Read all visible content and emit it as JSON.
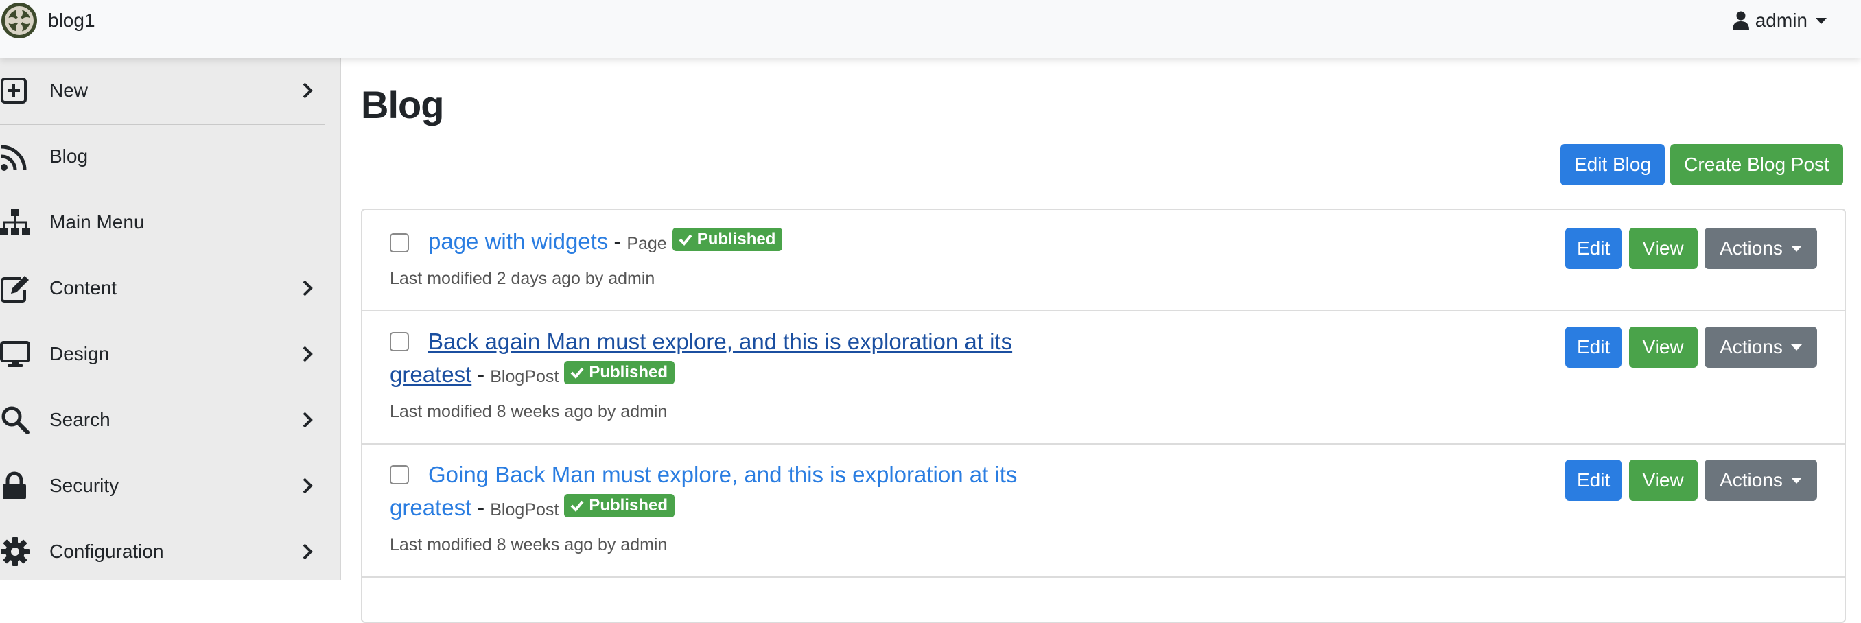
{
  "header": {
    "site_name": "blog1",
    "user": "admin"
  },
  "sidebar": {
    "items": [
      {
        "label": "New",
        "icon": "plus-square-icon",
        "has_submenu": true
      },
      {
        "label": "Blog",
        "icon": "rss-icon",
        "has_submenu": false
      },
      {
        "label": "Main Menu",
        "icon": "sitemap-icon",
        "has_submenu": false
      },
      {
        "label": "Content",
        "icon": "edit-icon",
        "has_submenu": true
      },
      {
        "label": "Design",
        "icon": "desktop-icon",
        "has_submenu": true
      },
      {
        "label": "Search",
        "icon": "search-icon",
        "has_submenu": true
      },
      {
        "label": "Security",
        "icon": "lock-icon",
        "has_submenu": true
      },
      {
        "label": "Configuration",
        "icon": "gear-icon",
        "has_submenu": true
      }
    ]
  },
  "main": {
    "title": "Blog",
    "actions": {
      "edit_blog": "Edit Blog",
      "create_post": "Create Blog Post"
    },
    "row_buttons": {
      "edit": "Edit",
      "view": "View",
      "actions": "Actions"
    },
    "posts": [
      {
        "title": "page with widgets",
        "type": "Page",
        "status": "Published",
        "modified": "Last modified 2 days ago by admin"
      },
      {
        "title_line1": "Back again Man must explore, and this is exploration at its",
        "title_line2": "greatest",
        "type": "BlogPost",
        "status": "Published",
        "modified": "Last modified 8 weeks ago by admin"
      },
      {
        "title_line1": "Going Back Man must explore, and this is exploration at its",
        "title_line2": "greatest",
        "type": "BlogPost",
        "status": "Published",
        "modified": "Last modified 8 weeks ago by admin"
      }
    ],
    "separator": "-"
  },
  "colors": {
    "primary": "#2a7de1",
    "success": "#4aa34a",
    "secondary": "#6c757d",
    "visited_link": "#1b4fa0"
  }
}
